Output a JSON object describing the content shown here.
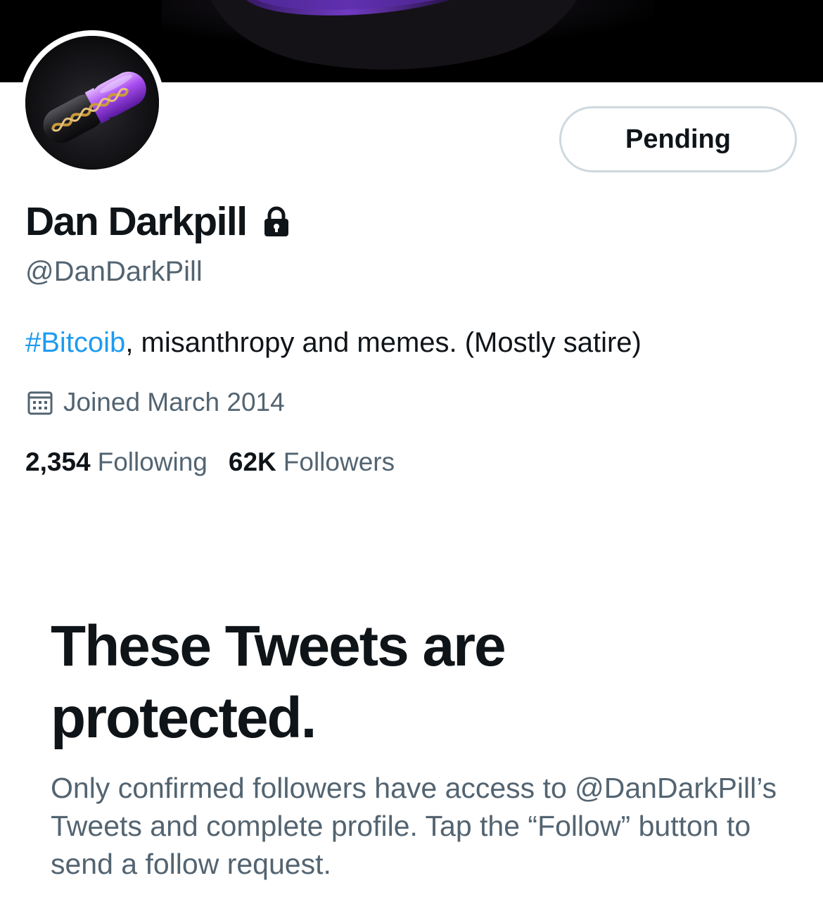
{
  "profile": {
    "display_name": "Dan Darkpill",
    "handle": "@DanDarkPill",
    "bio_hashtag": "#Bitcoib",
    "bio_rest": ", misanthropy and memes. (Mostly satire)",
    "joined": "Joined March 2014",
    "following_count": "2,354",
    "following_label": "Following",
    "followers_count": "62K",
    "followers_label": "Followers"
  },
  "actions": {
    "follow_state_label": "Pending"
  },
  "protected_notice": {
    "title": "These Tweets are protected.",
    "description": "Only confirmed followers have access to @DanDarkPill’s Tweets and complete profile. Tap the “Follow” button to send a follow request."
  },
  "icons": {
    "lock": "lock-icon",
    "calendar": "calendar-icon"
  },
  "colors": {
    "text_primary": "#0f1419",
    "text_secondary": "#536471",
    "link": "#1d9bf0",
    "border": "#cfd9de",
    "banner_bg": "#000000",
    "banner_glow": "#7b3fd6"
  }
}
